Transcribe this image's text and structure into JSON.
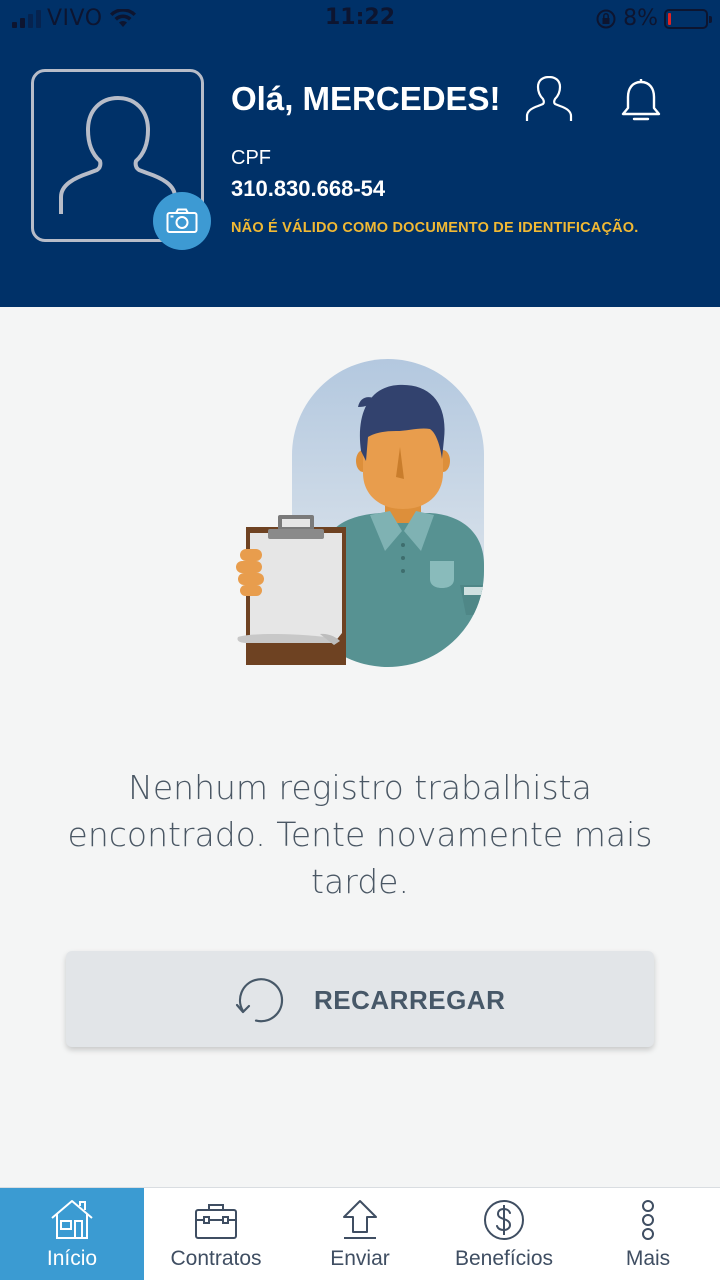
{
  "status_bar": {
    "carrier": "VIVO",
    "time": "11:22",
    "battery": "8%",
    "battery_level": 0.08
  },
  "header": {
    "greeting": "Olá, MERCEDES!",
    "cpf_label": "CPF",
    "cpf_value": "310.830.668-54",
    "warning": "NÃO É VÁLIDO COMO DOCUMENTO DE IDENTIFICAÇÃO.",
    "icons": [
      "avatar-placeholder-icon",
      "camera-icon",
      "profile-icon",
      "bell-icon"
    ]
  },
  "main": {
    "message": "Nenhum registro trabalhista encontrado. Tente novamente mais tarde.",
    "message_lines": [
      "Nenhum registro trabalhista",
      "encontrado. Tente novamente mais",
      "tarde."
    ],
    "reload_label": "RECARREGAR"
  },
  "bottom_nav": {
    "items": [
      {
        "label": "Início",
        "icon": "home-icon",
        "active": true
      },
      {
        "label": "Contratos",
        "icon": "briefcase-icon",
        "active": false
      },
      {
        "label": "Enviar",
        "icon": "upload-icon",
        "active": false
      },
      {
        "label": "Benefícios",
        "icon": "dollar-icon",
        "active": false
      },
      {
        "label": "Mais",
        "icon": "more-vertical-icon",
        "active": false
      }
    ]
  },
  "colors": {
    "header_bg": "#003168",
    "accent": "#3b9bd2",
    "warning": "#f1b934",
    "body_bg": "#f4f5f5",
    "text": "#4a5764"
  }
}
